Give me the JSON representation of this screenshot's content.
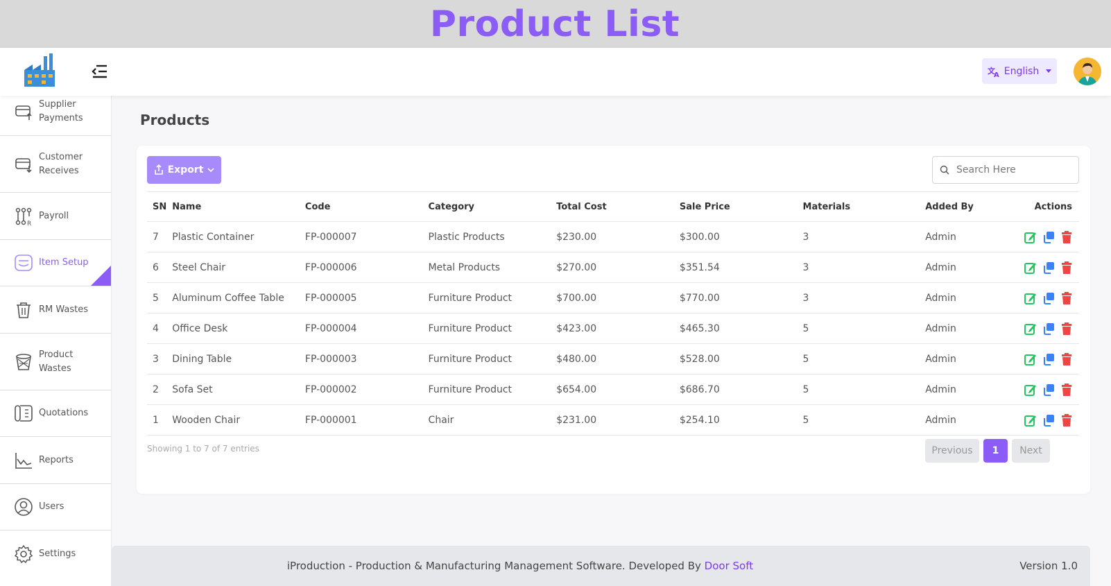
{
  "banner": {
    "title": "Product List"
  },
  "header": {
    "language": "English",
    "icons": {
      "logo": "factory-logo",
      "menu": "menu-collapse-icon",
      "language": "translate-icon",
      "avatar": "user-avatar"
    }
  },
  "sidebar": {
    "items": [
      {
        "label": "Supplier Payments",
        "icon": "supplier-payments-icon"
      },
      {
        "label": "Customer Receives",
        "icon": "customer-receives-icon"
      },
      {
        "label": "Payroll",
        "icon": "payroll-icon"
      },
      {
        "label": "Item Setup",
        "icon": "item-setup-icon",
        "active": true
      },
      {
        "label": "RM Wastes",
        "icon": "trash-icon"
      },
      {
        "label": "Product Wastes",
        "icon": "wastebasket-icon"
      },
      {
        "label": "Quotations",
        "icon": "quotations-icon"
      },
      {
        "label": "Reports",
        "icon": "reports-icon"
      },
      {
        "label": "Users",
        "icon": "user-icon"
      },
      {
        "label": "Settings",
        "icon": "gear-icon"
      }
    ]
  },
  "main": {
    "title": "Products",
    "export_label": "Export",
    "search_placeholder": "Search Here",
    "columns": [
      "SN",
      "Name",
      "Code",
      "Category",
      "Total Cost",
      "Sale Price",
      "Materials",
      "Added By",
      "Actions"
    ],
    "rows": [
      {
        "sn": "7",
        "name": "Plastic Container",
        "code": "FP-000007",
        "category": "Plastic Products",
        "total_cost": "$230.00",
        "sale_price": "$300.00",
        "materials": "3",
        "added_by": "Admin"
      },
      {
        "sn": "6",
        "name": "Steel Chair",
        "code": "FP-000006",
        "category": "Metal Products",
        "total_cost": "$270.00",
        "sale_price": "$351.54",
        "materials": "3",
        "added_by": "Admin"
      },
      {
        "sn": "5",
        "name": "Aluminum Coffee Table",
        "code": "FP-000005",
        "category": "Furniture Product",
        "total_cost": "$700.00",
        "sale_price": "$770.00",
        "materials": "3",
        "added_by": "Admin"
      },
      {
        "sn": "4",
        "name": "Office Desk",
        "code": "FP-000004",
        "category": "Furniture Product",
        "total_cost": "$423.00",
        "sale_price": "$465.30",
        "materials": "5",
        "added_by": "Admin"
      },
      {
        "sn": "3",
        "name": "Dining Table",
        "code": "FP-000003",
        "category": "Furniture Product",
        "total_cost": "$480.00",
        "sale_price": "$528.00",
        "materials": "5",
        "added_by": "Admin"
      },
      {
        "sn": "2",
        "name": "Sofa Set",
        "code": "FP-000002",
        "category": "Furniture Product",
        "total_cost": "$654.00",
        "sale_price": "$686.70",
        "materials": "5",
        "added_by": "Admin"
      },
      {
        "sn": "1",
        "name": "Wooden Chair",
        "code": "FP-000001",
        "category": "Chair",
        "total_cost": "$231.00",
        "sale_price": "$254.10",
        "materials": "5",
        "added_by": "Admin"
      }
    ],
    "showing": "Showing 1 to 7 of 7 entries",
    "pagination": {
      "previous": "Previous",
      "current": "1",
      "next": "Next"
    }
  },
  "footer": {
    "text": "iProduction - Production & Manufacturing Management Software. Developed By ",
    "developer": "Door Soft",
    "version": "Version 1.0"
  },
  "colors": {
    "accent": "#8b5cf6",
    "edit": "#22c55e",
    "copy": "#3b82f6",
    "delete": "#ef4444",
    "avatar_bg": "#f5b731"
  }
}
